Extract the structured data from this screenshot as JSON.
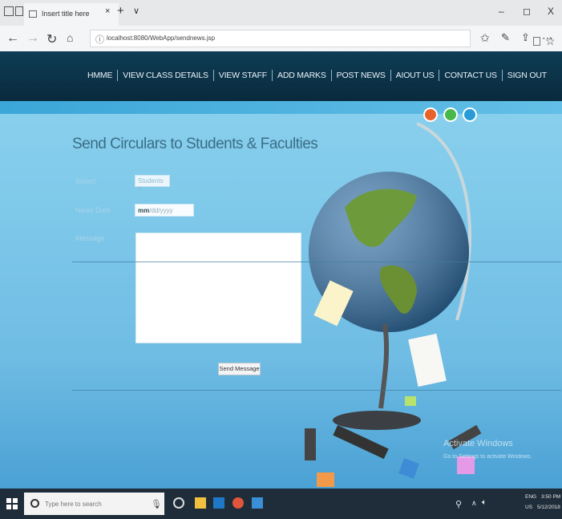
{
  "browser": {
    "tab_title": "Insert title here",
    "tab_close": "×",
    "new_tab": "+",
    "tab_menu": "∨",
    "url": "localhost:8080/WebApp/sendnews.jsp",
    "window_minimize": "–",
    "window_maximize": "◻",
    "window_close": "X"
  },
  "nav": {
    "items": [
      "HMME",
      "VIEW CLASS DETAILS",
      "VIEW STAFF",
      "ADD MARKS",
      "POST NEWS",
      "AIOUT US",
      "CONTACT US",
      "SIGN OUT"
    ]
  },
  "form": {
    "heading": "Send Circulars to Students & Faculties",
    "select_label": "Select",
    "select_value": "Students",
    "date_label": "News Date",
    "date_placeholder_bold": "mm",
    "date_placeholder_rest": "/dd/yyyy",
    "message_label": "Message",
    "send_button": "Send Message"
  },
  "watermark": {
    "title": "Activate Windows",
    "subtitle": "Go to Settings to activate Windows."
  },
  "taskbar": {
    "search_placeholder": "Type here to search",
    "lang_top": "ENG",
    "lang_bottom": "US",
    "time": "3:50 PM",
    "date": "5/12/2018"
  },
  "colors": {
    "nav_bg": "#0a2a3d",
    "page_bg": "#7fc9ea",
    "heading": "#3a6e86",
    "taskbar": "#1f2d3a"
  }
}
